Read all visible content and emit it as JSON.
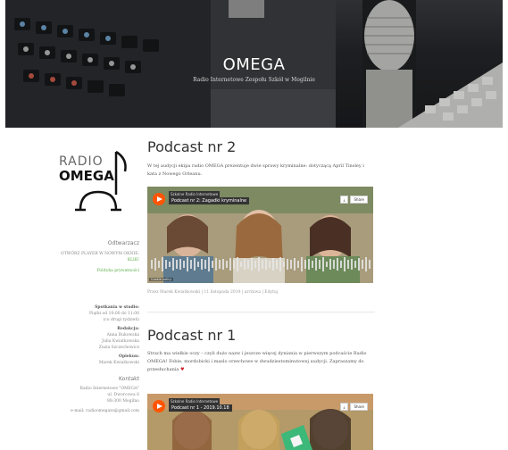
{
  "header": {
    "title": "OMEGA",
    "subtitle": "Radio Internetowe Zespołu Szkół w Mogilnie"
  },
  "sidebar": {
    "logo_text_top": "RADIO",
    "logo_text_bottom": "OMEGA",
    "player_section": {
      "title": "Odtwarzacz",
      "open_link": "OTWÓRZ PLAYER W NOWYM OKNIE:",
      "open_link_target": "KLIK!",
      "polls_link": "Polityka prywatności"
    },
    "meetings": {
      "label": "Spotkania w studio:",
      "line1": "Piątki od 10:00 do 11:00",
      "line2": "(co drugi tydzień)"
    },
    "editorial": {
      "label": "Redakcja:",
      "members": [
        "Anna Bukowska",
        "Julia Kwiatkowska",
        "Zuzia Szczechowicz"
      ]
    },
    "mentor": {
      "label": "Opiekun:",
      "name": "Marek Kwiatkowski"
    },
    "contact": {
      "title": "Kontakt",
      "lines": [
        "Radio Internetowe \"OMEGA\"",
        "ul. Dworcowa 6",
        "88-300 Mogilno",
        "e-mail: radioomegazs@gmail.com"
      ]
    }
  },
  "posts": [
    {
      "title": "Podcast nr 2",
      "text": "W tej audycji ekipa radio OMEGA prezentuje dwie sprawy kryminalne: dotyczącą April Tinsley i kata z Nowego Orleanu.",
      "player": {
        "user": "Szkolne Radio Internetowe",
        "track": "Podcast nr 2: Zagadki kryminalne",
        "share": "Share",
        "cookie": "Cookie policy"
      },
      "meta": "Przez Marek Kwiatkowski | 11 listopada 2019 | archiwa | Edytuj"
    },
    {
      "title": "Podcast nr 1",
      "text": "Strach ma wielkie oczy – czyli dużo nazw i jeszcze więcej dyniania w pierwszym podcaście Radio OMEGA! Fobie, mordobicki i maslo orzechowe w dwudziestominutowej audycji. Zapraszamy do przesłuchania",
      "heart": "♥",
      "player": {
        "user": "Szkolne Radio Internetowe",
        "track": "Podcast nr 1 - 2019.10.18",
        "share": "Share"
      }
    }
  ]
}
